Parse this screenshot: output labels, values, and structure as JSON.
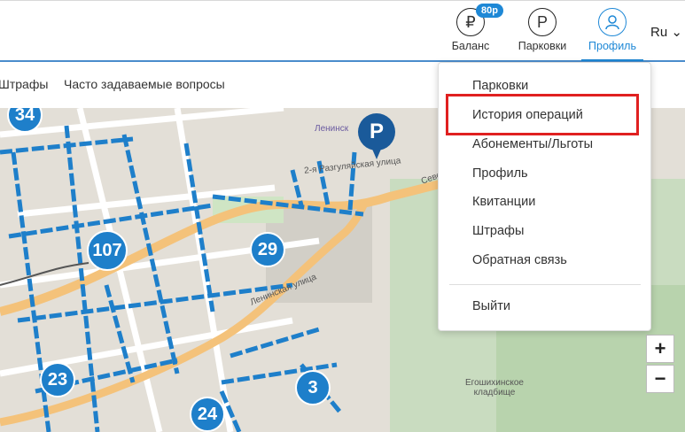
{
  "header": {
    "nav": [
      {
        "label": "Баланс",
        "icon": "₽",
        "badge": "80р"
      },
      {
        "label": "Парковки",
        "icon": "Р"
      },
      {
        "label": "Профиль",
        "icon": "user-icon"
      }
    ],
    "lang": "Ru"
  },
  "subbar": {
    "items": [
      "Штрафы",
      "Часто задаваемые вопросы"
    ]
  },
  "dropdown": {
    "items": [
      "Парковки",
      "История операций",
      "Абонементы/Льготы",
      "Профиль",
      "Квитанции",
      "Штрафы",
      "Обратная связь"
    ],
    "logout": "Выйти"
  },
  "map": {
    "clusters": [
      "34",
      "107",
      "29",
      "23",
      "3",
      "24"
    ],
    "pin": "P",
    "labels": [
      "Ленинск",
      "2-я Разгуляйская улица",
      "Севе",
      "Ленинская улица",
      "Егошихинское кладбище"
    ]
  },
  "colors": {
    "accent": "#1e88d6",
    "highlight": "#e02020"
  }
}
